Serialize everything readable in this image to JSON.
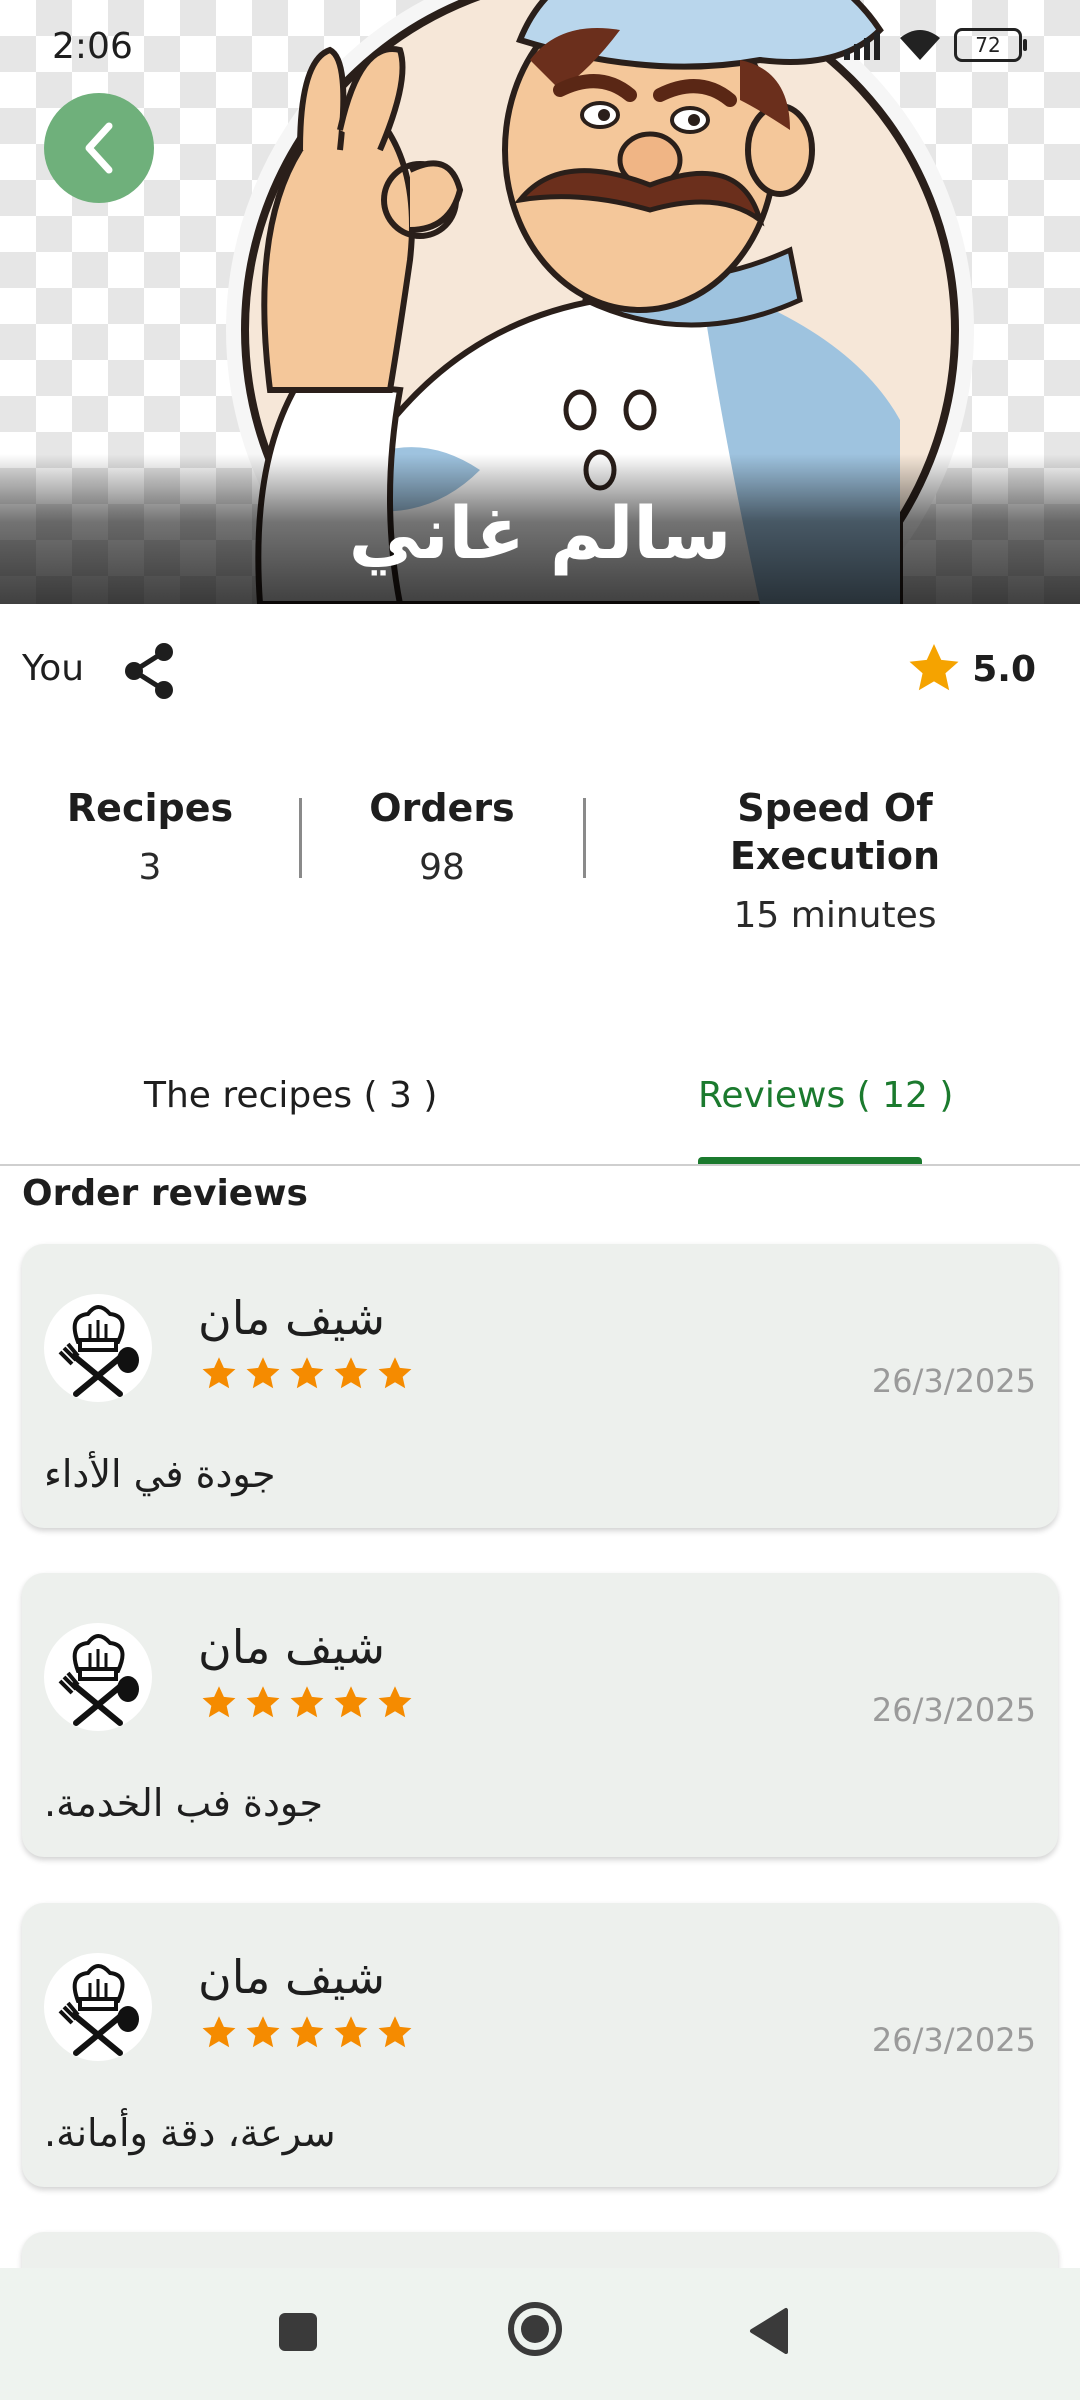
{
  "status_bar": {
    "time": "2:06",
    "battery": "72"
  },
  "header": {
    "chef_name": "سالم غاني"
  },
  "profile": {
    "owner_label": "You",
    "rating": "5.0"
  },
  "stats": [
    {
      "label": "Recipes",
      "value": "3"
    },
    {
      "label": "Orders",
      "value": "98"
    },
    {
      "label": "Speed Of Execution",
      "value": "15 minutes"
    }
  ],
  "tabs": [
    {
      "label": "The recipes ( 3 )",
      "active": false
    },
    {
      "label": "Reviews ( 12 )",
      "active": true
    }
  ],
  "reviews_section": {
    "title": "Order reviews",
    "items": [
      {
        "reviewer": "شيف مان",
        "stars": 5,
        "date": "26/3/2025",
        "comment": "جودة في الأداء"
      },
      {
        "reviewer": "شيف مان",
        "stars": 5,
        "date": "26/3/2025",
        "comment": "جودة فب الخدمة."
      },
      {
        "reviewer": "شيف مان",
        "stars": 5,
        "date": "26/3/2025",
        "comment": "سرعة، دقة وأمانة."
      }
    ]
  },
  "colors": {
    "accent": "#1b7a2e",
    "back_button": "#6fb07b",
    "star": "#f5a300",
    "review_star": "#f58b00",
    "card_bg": "#edf0ed"
  },
  "icons": {
    "back": "chevron-left-icon",
    "share": "share-icon",
    "rating": "star-icon",
    "nav_recent": "square-icon",
    "nav_home": "circle-icon",
    "nav_back": "triangle-back-icon"
  }
}
